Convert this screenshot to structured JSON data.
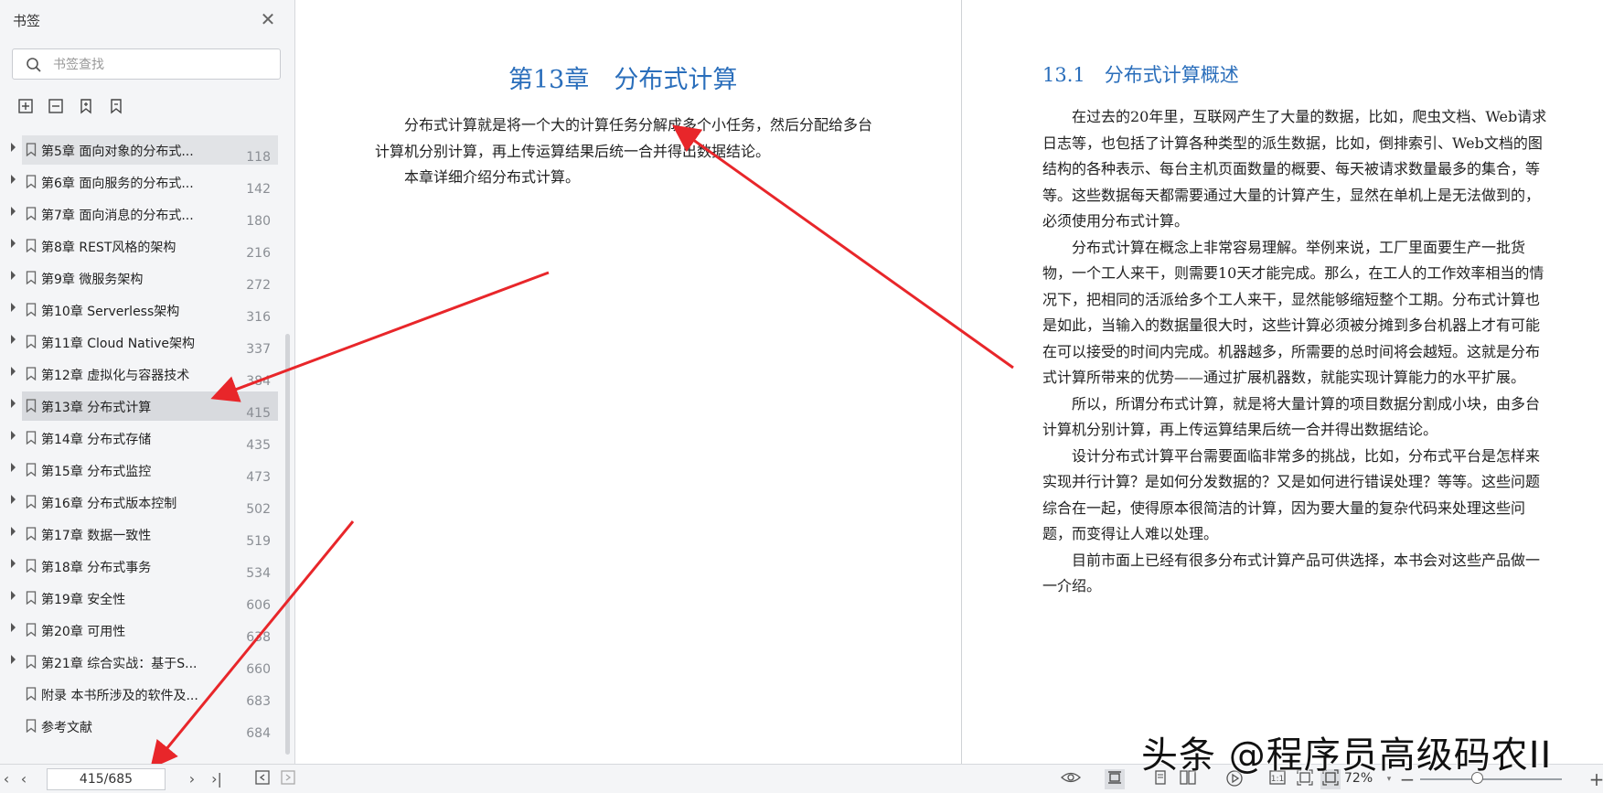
{
  "sidebar": {
    "title": "书签",
    "search_placeholder": "书签查找",
    "items": [
      {
        "label": "第5章 面向对象的分布式...",
        "page": "118",
        "expandable": true
      },
      {
        "label": "第6章 面向服务的分布式...",
        "page": "142",
        "expandable": true
      },
      {
        "label": "第7章 面向消息的分布式...",
        "page": "180",
        "expandable": true
      },
      {
        "label": "第8章 REST风格的架构",
        "page": "216",
        "expandable": true
      },
      {
        "label": "第9章 微服务架构",
        "page": "272",
        "expandable": true
      },
      {
        "label": "第10章 Serverless架构",
        "page": "316",
        "expandable": true
      },
      {
        "label": "第11章 Cloud Native架构",
        "page": "337",
        "expandable": true
      },
      {
        "label": "第12章 虚拟化与容器技术",
        "page": "384",
        "expandable": true
      },
      {
        "label": "第13章 分布式计算",
        "page": "415",
        "expandable": true,
        "active": true
      },
      {
        "label": "第14章 分布式存储",
        "page": "435",
        "expandable": true
      },
      {
        "label": "第15章 分布式监控",
        "page": "473",
        "expandable": true
      },
      {
        "label": "第16章 分布式版本控制",
        "page": "502",
        "expandable": true
      },
      {
        "label": "第17章 数据一致性",
        "page": "519",
        "expandable": true
      },
      {
        "label": "第18章 分布式事务",
        "page": "534",
        "expandable": true
      },
      {
        "label": "第19章 安全性",
        "page": "606",
        "expandable": true
      },
      {
        "label": "第20章 可用性",
        "page": "638",
        "expandable": true
      },
      {
        "label": "第21章 综合实战：基于S...",
        "page": "660",
        "expandable": true
      },
      {
        "label": "附录 本书所涉及的软件及...",
        "page": "683",
        "expandable": false
      },
      {
        "label": "参考文献",
        "page": "684",
        "expandable": false
      }
    ]
  },
  "document": {
    "left_page": {
      "chapter_title": "第13章　分布式计算",
      "paragraphs": [
        "分布式计算就是将一个大的计算任务分解成多个小任务，然后分配给多台计算机分别计算，再上传运算结果后统一合并得出数据结论。",
        "本章详细介绍分布式计算。"
      ]
    },
    "right_page": {
      "section_title": "13.1　分布式计算概述",
      "paragraphs": [
        "在过去的20年里，互联网产生了大量的数据，比如，爬虫文档、Web请求日志等，也包括了计算各种类型的派生数据，比如，倒排索引、Web文档的图结构的各种表示、每台主机页面数量的概要、每天被请求数量最多的集合，等等。这些数据每天都需要通过大量的计算产生，显然在单机上是无法做到的，必须使用分布式计算。",
        "分布式计算在概念上非常容易理解。举例来说，工厂里面要生产一批货物，一个工人来干，则需要10天才能完成。那么，在工人的工作效率相当的情况下，把相同的活派给多个工人来干，显然能够缩短整个工期。分布式计算也是如此，当输入的数据量很大时，这些计算必须被分摊到多台机器上才有可能在可以接受的时间内完成。机器越多，所需要的总时间将会越短。这就是分布式计算所带来的优势——通过扩展机器数，就能实现计算能力的水平扩展。",
        "所以，所谓分布式计算，就是将大量计算的项目数据分割成小块，由多台计算机分别计算，再上传运算结果后统一合并得出数据结论。",
        "设计分布式计算平台需要面临非常多的挑战，比如，分布式平台是怎样来实现并行计算？是如何分发数据的？又是如何进行错误处理？等等。这些问题综合在一起，使得原本很简洁的计算，因为要大量的复杂代码来处理这些问题，而变得让人难以处理。",
        "目前市面上已经有很多分布式计算产品可供选择，本书会对这些产品做一一介绍。"
      ]
    }
  },
  "bottombar": {
    "page_indicator": "415/685",
    "zoom": "72%",
    "zoom_fraction": 0.36
  },
  "watermark": "头条 @程序员高级码农II",
  "colors": {
    "heading_blue": "#2a6ebb",
    "annotation_red": "#e8262a"
  }
}
